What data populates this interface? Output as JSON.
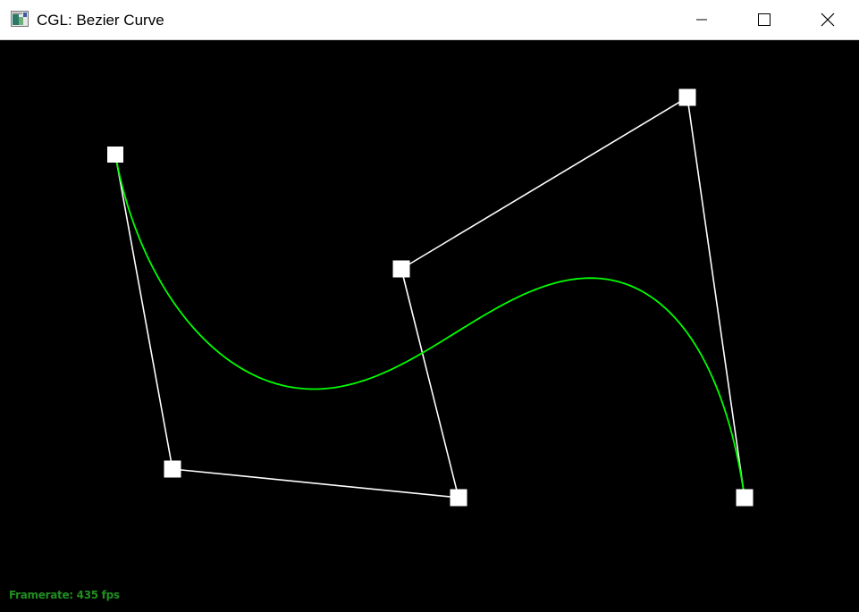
{
  "window": {
    "title": "CGL: Bezier Curve",
    "app_icon": "application-window-icon",
    "controls": [
      {
        "name": "minimize-icon",
        "glyph": "minimize"
      },
      {
        "name": "maximize-icon",
        "glyph": "maximize"
      },
      {
        "name": "close-icon",
        "glyph": "close"
      }
    ]
  },
  "scene": {
    "background_color": "#000000",
    "curve_color": "#00ff00",
    "control_polygon_color": "#ffffff",
    "control_point_color": "#ffffff"
  },
  "status": {
    "framerate": "Framerate: 435 fps",
    "color": "#1f8f1f"
  }
}
